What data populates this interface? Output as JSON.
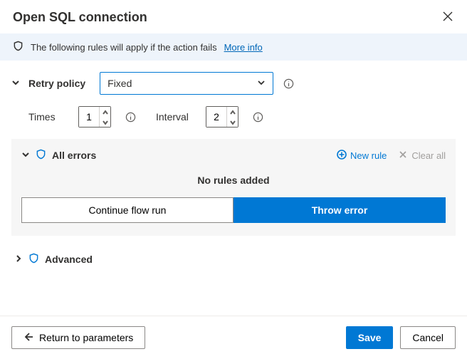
{
  "header": {
    "title": "Open SQL connection"
  },
  "info_bar": {
    "text": "The following rules will apply if the action fails",
    "link": "More info"
  },
  "retry": {
    "label": "Retry policy",
    "selected": "Fixed",
    "times_label": "Times",
    "times_value": "1",
    "interval_label": "Interval",
    "interval_value": "2"
  },
  "errors_panel": {
    "title": "All errors",
    "new_rule": "New rule",
    "clear_all": "Clear all",
    "empty_text": "No rules added",
    "continue_label": "Continue flow run",
    "throw_label": "Throw error"
  },
  "advanced": {
    "label": "Advanced"
  },
  "footer": {
    "return_label": "Return to parameters",
    "save_label": "Save",
    "cancel_label": "Cancel"
  }
}
